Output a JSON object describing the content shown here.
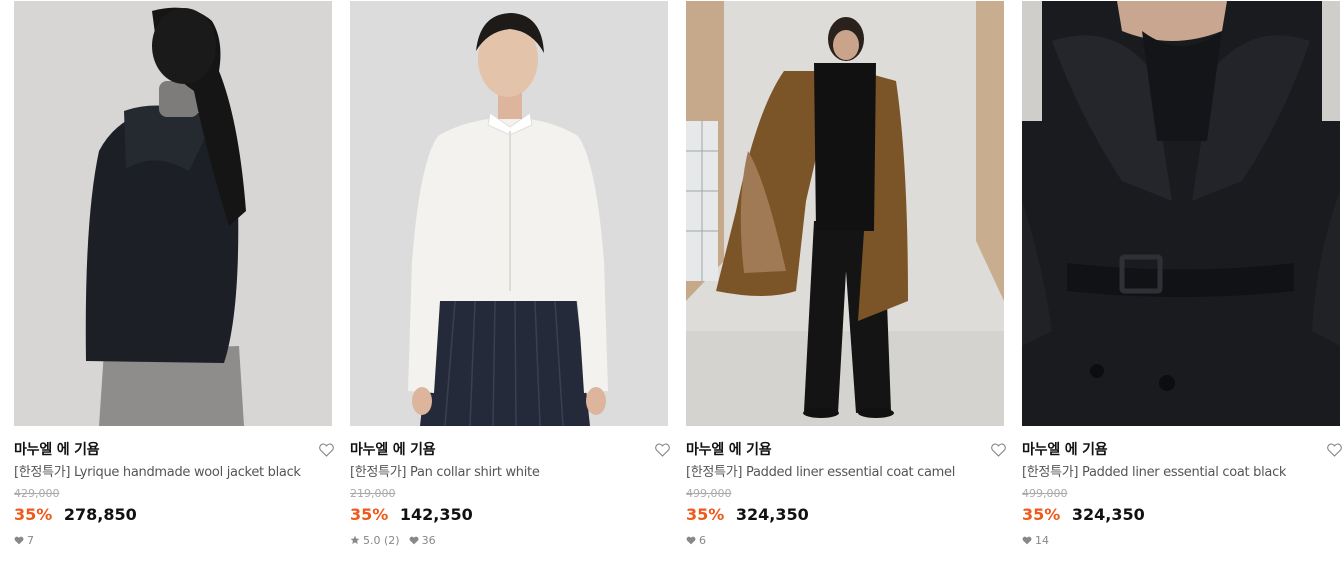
{
  "products": [
    {
      "brand": "마누엘 에 기욤",
      "name": "[한정특가] Lyrique handmade wool jacket black",
      "original_price": "429,000",
      "discount": "35%",
      "price": "278,850",
      "likes": "7"
    },
    {
      "brand": "마누엘 에 기욤",
      "name": "[한정특가] Pan collar shirt white",
      "original_price": "219,000",
      "discount": "35%",
      "price": "142,350",
      "rating": "5.0 (2)",
      "likes": "36"
    },
    {
      "brand": "마누엘 에 기욤",
      "name": "[한정특가] Padded liner essential coat camel",
      "original_price": "499,000",
      "discount": "35%",
      "price": "324,350",
      "likes": "6"
    },
    {
      "brand": "마누엘 에 기욤",
      "name": "[한정특가] Padded liner essential coat black",
      "original_price": "499,000",
      "discount": "35%",
      "price": "324,350",
      "likes": "14"
    }
  ],
  "colors": {
    "discount": "#ef5a1a",
    "brand_text": "#111111",
    "name_text": "#555555",
    "muted": "#888888"
  },
  "icons": {
    "wishlist": "heart-outline-icon",
    "likes": "heart-filled-icon",
    "rating": "star-icon"
  }
}
